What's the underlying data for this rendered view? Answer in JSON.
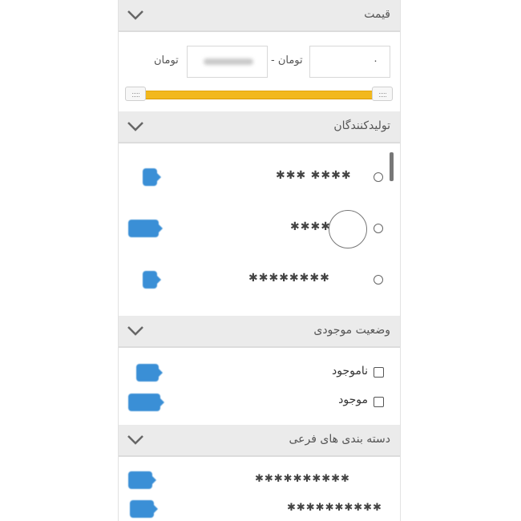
{
  "sections": {
    "price": {
      "title": "قیمت"
    },
    "manufacturers": {
      "title": "تولیدکنندگان"
    },
    "availability": {
      "title": "وضعیت موجودی"
    },
    "subcategories": {
      "title": "دسته بندی های فرعی"
    }
  },
  "price": {
    "min_value": "۰",
    "min_unit": "تومان -",
    "max_unit": "تومان",
    "slider_min_fraction": 0,
    "slider_max_fraction": 1
  },
  "manufacturers": [
    {
      "name": "✱✱✱ ✱✱✱✱"
    },
    {
      "name": "✱✱✱✱"
    },
    {
      "name": "✱✱✱✱✱✱✱✱"
    }
  ],
  "availability": [
    {
      "label": "ناموجود"
    },
    {
      "label": "موجود"
    }
  ],
  "subcategories": [
    {
      "name": "✱✱✱✱✱✱✱✱✱✱"
    },
    {
      "name": "✱✱✱✱✱✱✱✱✱✱"
    }
  ],
  "colors": {
    "accent": "#f2b81d",
    "badge": "#3a8fd6",
    "header": "#ebebeb"
  }
}
